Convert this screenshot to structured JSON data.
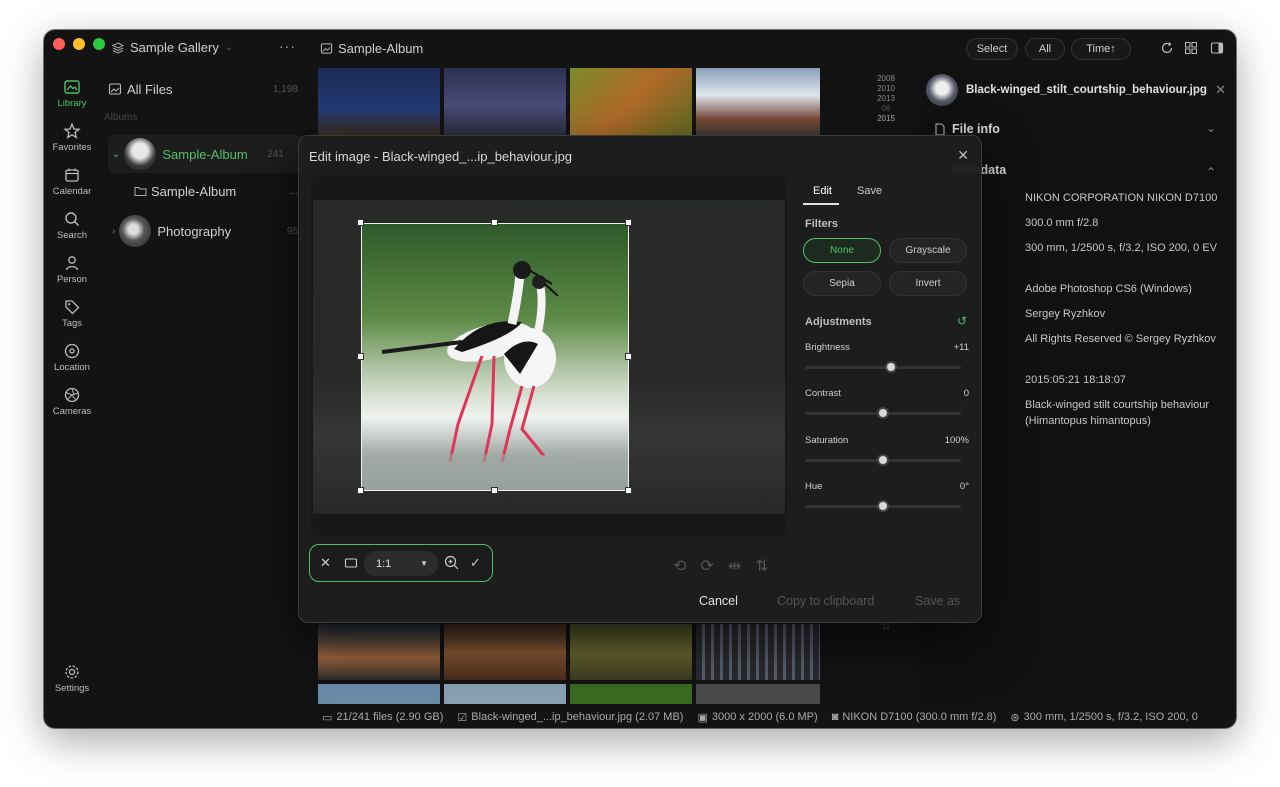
{
  "app": {
    "gallery_name": "Sample Gallery",
    "album_title": "Sample-Album",
    "accent": "#4fc06a"
  },
  "rail": {
    "items": [
      {
        "label": "Library",
        "icon": "library-icon"
      },
      {
        "label": "Favorites",
        "icon": "star-icon"
      },
      {
        "label": "Calendar",
        "icon": "calendar-icon"
      },
      {
        "label": "Search",
        "icon": "search-icon"
      },
      {
        "label": "Person",
        "icon": "person-icon"
      },
      {
        "label": "Tags",
        "icon": "tag-icon"
      },
      {
        "label": "Location",
        "icon": "location-icon"
      },
      {
        "label": "Cameras",
        "icon": "aperture-icon"
      }
    ],
    "settings": "Settings"
  },
  "sidebar": {
    "all_files": "All Files",
    "all_files_count": "1,198",
    "albums_section": "Albums",
    "albums": [
      {
        "name": "Sample-Album",
        "count": "241"
      },
      {
        "name": "Sample-Album",
        "count": "..."
      },
      {
        "name": "Photography",
        "count": "95"
      }
    ]
  },
  "toolbar": {
    "select": "Select",
    "filter": "All",
    "sort": "Time↑"
  },
  "timeline": [
    "2008",
    "2010",
    "2013",
    "06",
    "2015",
    "11"
  ],
  "info": {
    "filename": "Black-winged_stilt_courtship_behaviour.jpg",
    "file_info": "File info",
    "metadata": "Metadata",
    "values": [
      "NIKON CORPORATION NIKON D7100",
      "300.0 mm f/2.8",
      "300 mm, 1/2500 s, f/3.2, ISO 200, 0 EV",
      "Adobe Photoshop CS6 (Windows)",
      "Sergey Ryzhkov",
      "All Rights Reserved © Sergey Ryzhkov",
      "2015:05:21 18:18:07",
      "Black-winged stilt courtship behaviour (Himantopus himantopus)"
    ],
    "partial_labels": [
      "nt",
      "ion"
    ]
  },
  "status": {
    "files": "21/241 files (2.90 GB)",
    "selected": "Black-winged_...ip_behaviour.jpg (2.07 MB)",
    "dimensions": "3000 x 2000 (6.0 MP)",
    "camera": "NIKON D7100 (300.0 mm f/2.8)",
    "exposure": "300 mm, 1/2500 s, f/3.2, ISO 200, 0"
  },
  "modal": {
    "title": "Edit image - Black-winged_...ip_behaviour.jpg",
    "tabs": [
      "Edit",
      "Save"
    ],
    "filters_heading": "Filters",
    "filters": [
      "None",
      "Grayscale",
      "Sepia",
      "Invert"
    ],
    "active_filter": "None",
    "adjustments_heading": "Adjustments",
    "adjustments": [
      {
        "name": "Brightness",
        "value": "+11",
        "level": 0.55
      },
      {
        "name": "Contrast",
        "value": "0",
        "level": 0.5
      },
      {
        "name": "Saturation",
        "value": "100%",
        "level": 0.5
      },
      {
        "name": "Hue",
        "value": "0°",
        "level": 0.5
      }
    ],
    "ratio": "1:1",
    "cancel": "Cancel",
    "copy": "Copy to clipboard",
    "save_as": "Save as"
  }
}
